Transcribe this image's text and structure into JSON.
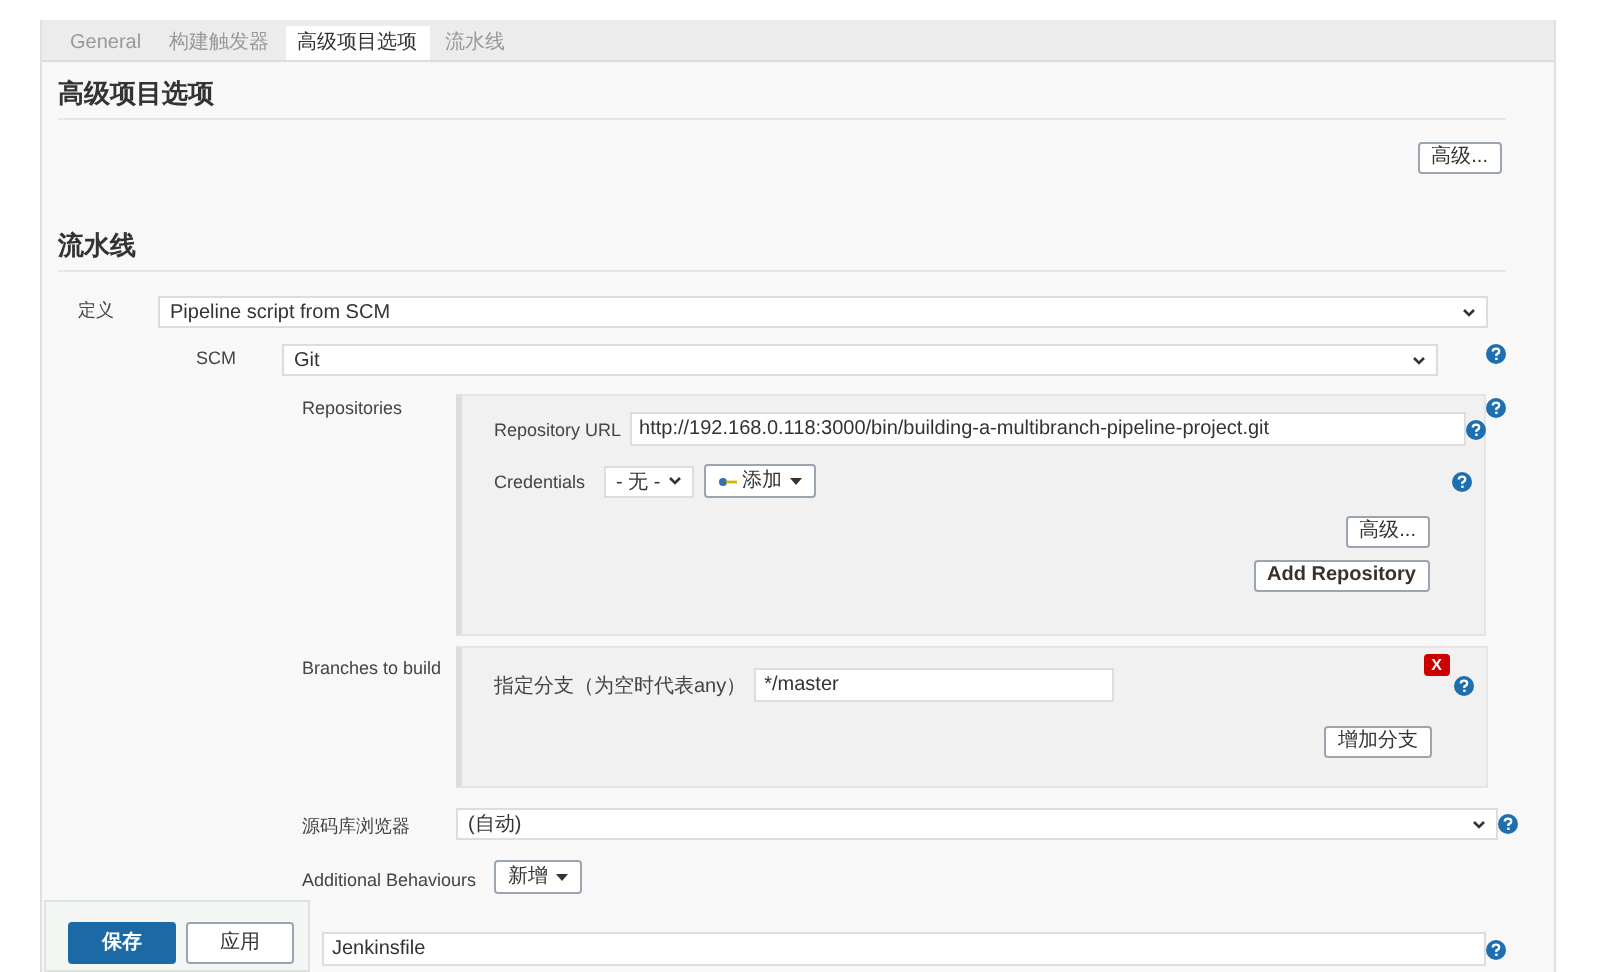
{
  "tabs": [
    {
      "label": "General",
      "selected": false
    },
    {
      "label": "构建触发器",
      "selected": false
    },
    {
      "label": "高级项目选项",
      "selected": true
    },
    {
      "label": "流水线",
      "selected": false
    }
  ],
  "advanced_section": {
    "title": "高级项目选项",
    "advanced_button": "高级..."
  },
  "pipeline_section": {
    "title": "流水线",
    "definition": {
      "label": "定义",
      "value": "Pipeline script from SCM"
    },
    "scm": {
      "label": "SCM",
      "value": "Git"
    },
    "repositories": {
      "label": "Repositories",
      "url_label": "Repository URL",
      "url_value": "http://192.168.0.118:3000/bin/building-a-multibranch-pipeline-project.git",
      "credentials_label": "Credentials",
      "credentials_value": "- 无 -",
      "add_button": "添加",
      "advanced_button": "高级...",
      "add_repository_button": "Add Repository"
    },
    "branches": {
      "label": "Branches to build",
      "delete_button": "X",
      "branch_label": "指定分支（为空时代表any）",
      "branch_value": "*/master",
      "add_branch_button": "增加分支"
    },
    "browser": {
      "label": "源码库浏览器",
      "value": "(自动)"
    },
    "additional_behaviours": {
      "label": "Additional Behaviours",
      "add_button": "新增"
    },
    "script_path": {
      "value": "Jenkinsfile"
    }
  },
  "save_bar": {
    "save_button": "保存",
    "apply_button": "应用"
  }
}
